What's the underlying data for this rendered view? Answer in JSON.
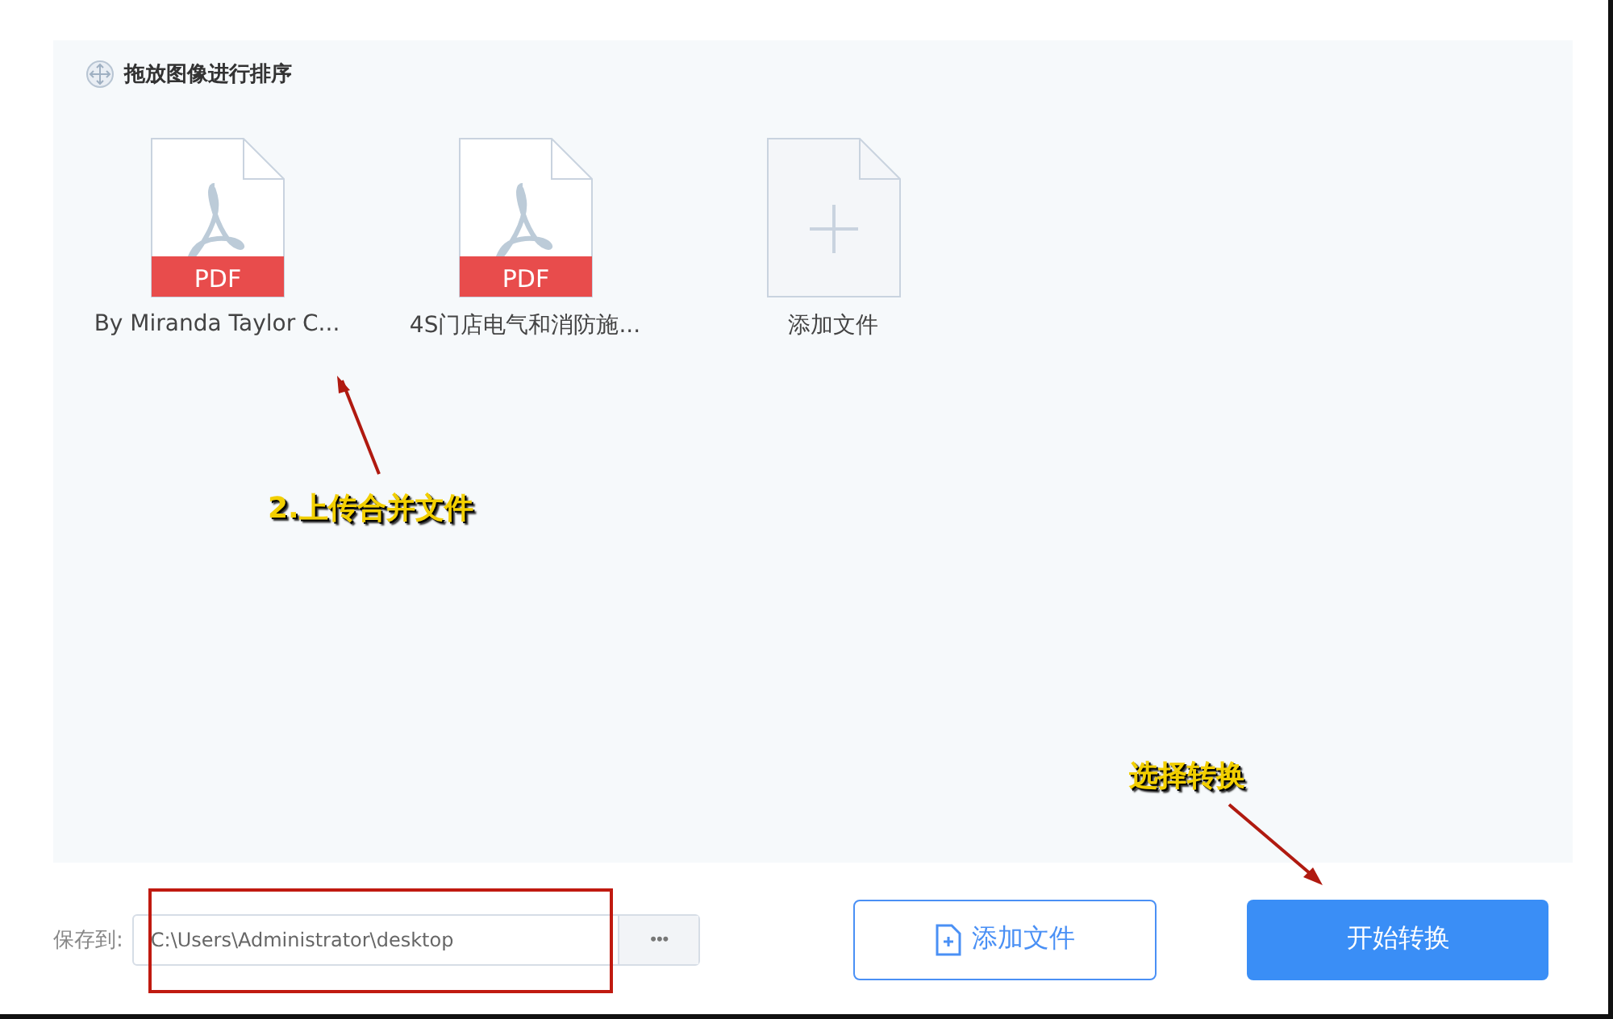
{
  "drop_area": {
    "hint": "拖放图像进行排序",
    "files": [
      {
        "kind": "pdf",
        "badge": "PDF",
        "name": "By Miranda Taylor C..."
      },
      {
        "kind": "pdf",
        "badge": "PDF",
        "name": "4S门店电气和消防施..."
      },
      {
        "kind": "add",
        "name": "添加文件"
      }
    ]
  },
  "annotations": [
    {
      "text": "2.上传合并文件"
    },
    {
      "text": "选择转换"
    }
  ],
  "footer": {
    "save_label": "保存到:",
    "save_path": "C:\\Users\\Administrator\\desktop",
    "browse": "•••",
    "add_button": "添加文件",
    "start_button": "开始转换"
  }
}
